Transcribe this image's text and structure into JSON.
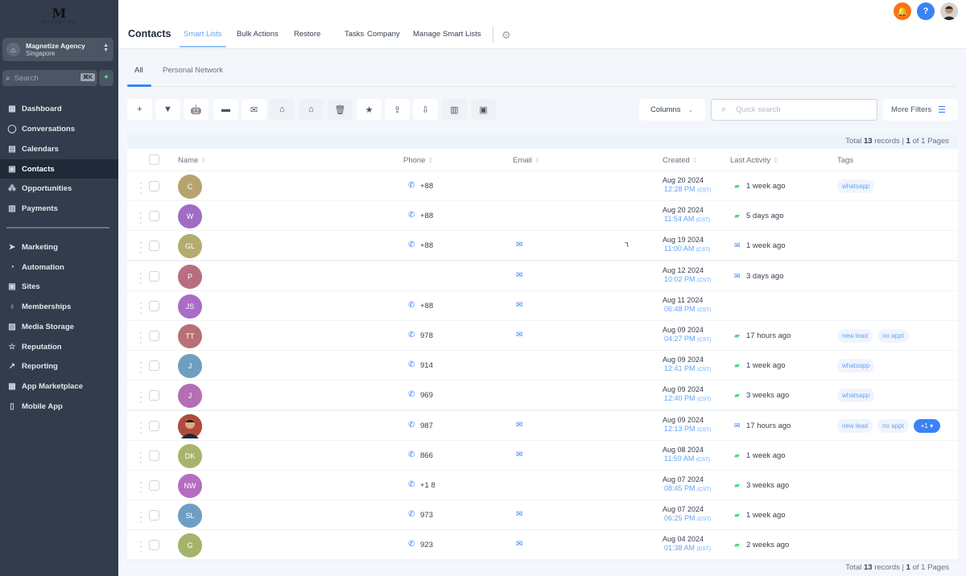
{
  "brand": {
    "logo_letter": "M",
    "logo_text": "MAGNETIZE"
  },
  "agency": {
    "name": "Magnetize Agency",
    "location": "Singapore"
  },
  "sidebar_search": {
    "placeholder": "Search",
    "shortcut": "⌘K"
  },
  "sidebar": {
    "items": [
      {
        "label": "Dashboard",
        "icon": "dashboard-icon",
        "glyph": "▦",
        "active": false
      },
      {
        "label": "Conversations",
        "icon": "chat-bubble-icon",
        "glyph": "◯",
        "active": false
      },
      {
        "label": "Calendars",
        "icon": "calendar-icon",
        "glyph": "▤",
        "active": false
      },
      {
        "label": "Contacts",
        "icon": "contacts-book-icon",
        "glyph": "▣",
        "active": true
      },
      {
        "label": "Opportunities",
        "icon": "opportunities-icon",
        "glyph": "⁂",
        "active": false
      },
      {
        "label": "Payments",
        "icon": "payments-icon",
        "glyph": "▥",
        "active": false
      },
      {
        "label": "Marketing",
        "icon": "send-icon",
        "glyph": "➤",
        "active": false
      },
      {
        "label": "Automation",
        "icon": "automation-icon",
        "glyph": "◔",
        "active": false
      },
      {
        "label": "Sites",
        "icon": "sites-icon",
        "glyph": "▣",
        "active": false
      },
      {
        "label": "Memberships",
        "icon": "award-icon",
        "glyph": "♁",
        "active": false
      },
      {
        "label": "Media Storage",
        "icon": "image-icon",
        "glyph": "▨",
        "active": false
      },
      {
        "label": "Reputation",
        "icon": "star-icon",
        "glyph": "☆",
        "active": false
      },
      {
        "label": "Reporting",
        "icon": "trend-icon",
        "glyph": "↗",
        "active": false
      },
      {
        "label": "App Marketplace",
        "icon": "apps-grid-icon",
        "glyph": "▦",
        "active": false
      },
      {
        "label": "Mobile App",
        "icon": "mobile-icon",
        "glyph": "▯",
        "active": false
      }
    ]
  },
  "header": {
    "title": "Contacts",
    "tabs": [
      {
        "label": "Smart Lists",
        "active": true
      },
      {
        "label": "Bulk Actions",
        "active": false
      },
      {
        "label": "Restore",
        "active": false
      },
      {
        "label": "Tasks",
        "active": false
      },
      {
        "label": "Company",
        "active": false
      },
      {
        "label": "Manage Smart Lists",
        "active": false
      }
    ],
    "notification_color": "#f97316",
    "help_color": "#3b82f6"
  },
  "subtabs": [
    {
      "label": "All",
      "active": true
    },
    {
      "label": "Personal Network",
      "active": false
    }
  ],
  "toolbar": {
    "buttons": [
      {
        "name": "add-contact",
        "glyph": "+"
      },
      {
        "name": "filter",
        "glyph": "▼"
      },
      {
        "name": "automation-bot",
        "glyph": "🤖"
      },
      {
        "name": "send-sms",
        "glyph": "▬"
      },
      {
        "name": "send-email",
        "glyph": "✉"
      },
      {
        "name": "add-tag",
        "glyph": "⌂"
      },
      {
        "name": "remove-tag",
        "glyph": "⌂"
      },
      {
        "name": "delete",
        "glyph": "🗑"
      },
      {
        "name": "favorite",
        "glyph": "★"
      },
      {
        "name": "import",
        "glyph": "⇪"
      },
      {
        "name": "export",
        "glyph": "⇩"
      },
      {
        "name": "company",
        "glyph": "▥"
      },
      {
        "name": "merge",
        "glyph": "▣"
      }
    ],
    "columns_label": "Columns",
    "search_placeholder": "Quick search",
    "more_filters_label": "More Filters"
  },
  "pagination": {
    "prefix": "Total",
    "count": "13",
    "mid": "records |",
    "page": "1",
    "suffix": "of 1 Pages"
  },
  "table": {
    "headers": {
      "name": "Name",
      "phone": "Phone",
      "email": "Email",
      "created": "Created",
      "last_activity": "Last Activity",
      "tags": "Tags"
    },
    "rows": [
      {
        "initials": "C",
        "color": "#b5a46e",
        "phone": "+88",
        "email": false,
        "extra": "",
        "date": "Aug 20 2024",
        "time": "12:28 PM",
        "tz": "(CST)",
        "activity_type": "sms",
        "activity": "1 week ago",
        "tags": [
          "whatsapp"
        ],
        "more": ""
      },
      {
        "initials": "W",
        "color": "#a06cc4",
        "phone": "+88",
        "email": false,
        "extra": "",
        "date": "Aug 20 2024",
        "time": "11:54 AM",
        "tz": "(CST)",
        "activity_type": "sms",
        "activity": "5 days ago",
        "tags": [],
        "more": ""
      },
      {
        "initials": "GL",
        "color": "#b3ac6e",
        "phone": "+88",
        "email": true,
        "extra": "٦",
        "date": "Aug 19 2024",
        "time": "11:00 AM",
        "tz": "(CST)",
        "activity_type": "mail",
        "activity": "1 week ago",
        "tags": [],
        "more": ""
      },
      {
        "initials": "P",
        "color": "#b86e7f",
        "phone": "",
        "email": true,
        "extra": "",
        "date": "Aug 12 2024",
        "time": "10:02 PM",
        "tz": "(CST)",
        "activity_type": "mail",
        "activity": "3 days ago",
        "tags": [],
        "more": ""
      },
      {
        "initials": "JS",
        "color": "#a96cc8",
        "phone": "+88",
        "email": true,
        "extra": "",
        "date": "Aug 11 2024",
        "time": "06:48 PM",
        "tz": "(CST)",
        "activity_type": "",
        "activity": "",
        "tags": [],
        "more": ""
      },
      {
        "initials": "TT",
        "color": "#b87075",
        "phone": "978",
        "email": true,
        "extra": "",
        "date": "Aug 09 2024",
        "time": "04:27 PM",
        "tz": "(CST)",
        "activity_type": "sms",
        "activity": "17 hours ago",
        "tags": [
          "new lead",
          "no appt"
        ],
        "more": ""
      },
      {
        "initials": "J",
        "color": "#6e9fc0",
        "phone": "914",
        "email": false,
        "extra": "",
        "date": "Aug 09 2024",
        "time": "12:41 PM",
        "tz": "(CST)",
        "activity_type": "sms",
        "activity": "1 week ago",
        "tags": [
          "whatsapp"
        ],
        "more": ""
      },
      {
        "initials": "J",
        "color": "#b46eb4",
        "phone": "969",
        "email": false,
        "extra": "",
        "date": "Aug 09 2024",
        "time": "12:40 PM",
        "tz": "(CST)",
        "activity_type": "sms",
        "activity": "3 weeks ago",
        "tags": [
          "whatsapp"
        ],
        "more": ""
      },
      {
        "initials": "",
        "color": "#b14a3e",
        "photo": true,
        "phone": "987",
        "email": true,
        "extra": "",
        "date": "Aug 09 2024",
        "time": "12:13 PM",
        "tz": "(CST)",
        "activity_type": "mail",
        "activity": "17 hours ago",
        "tags": [
          "new lead",
          "no appt"
        ],
        "more": "+1 ▾"
      },
      {
        "initials": "DK",
        "color": "#a8b46c",
        "phone": "866",
        "email": true,
        "extra": "",
        "date": "Aug 08 2024",
        "time": "11:59 AM",
        "tz": "(CST)",
        "activity_type": "sms",
        "activity": "1 week ago",
        "tags": [],
        "more": ""
      },
      {
        "initials": "NW",
        "color": "#b66cc0",
        "phone": "+1 8",
        "email": false,
        "extra": "",
        "date": "Aug 07 2024",
        "time": "08:45 PM",
        "tz": "(CST)",
        "activity_type": "sms",
        "activity": "3 weeks ago",
        "tags": [],
        "more": ""
      },
      {
        "initials": "SL",
        "color": "#6e9ec4",
        "phone": "973",
        "email": true,
        "extra": "",
        "date": "Aug 07 2024",
        "time": "06:25 PM",
        "tz": "(CST)",
        "activity_type": "sms",
        "activity": "1 week ago",
        "tags": [],
        "more": ""
      },
      {
        "initials": "G",
        "color": "#a3b46a",
        "phone": "923",
        "email": true,
        "extra": "",
        "date": "Aug 04 2024",
        "time": "01:38 AM",
        "tz": "(CST)",
        "activity_type": "sms",
        "activity": "2 weeks ago",
        "tags": [],
        "more": ""
      }
    ]
  }
}
